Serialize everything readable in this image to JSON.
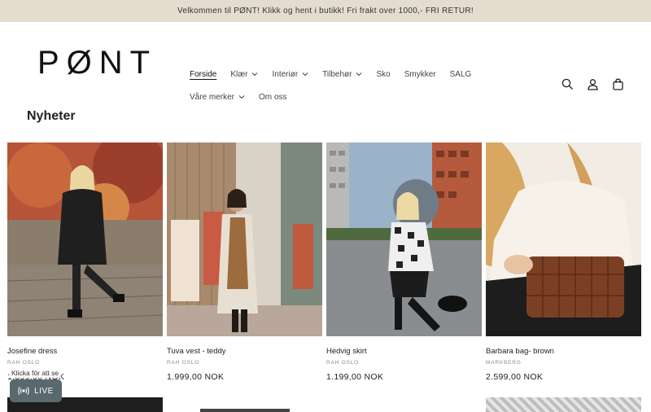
{
  "announcement": "Velkommen til PØNT! Klikk og hent i butikk! Fri frakt over 1000,- FRI RETUR!",
  "brand": {
    "logo_text": "PØNT"
  },
  "nav": [
    {
      "label": "Forside",
      "dropdown": false,
      "active": true
    },
    {
      "label": "Klær",
      "dropdown": true
    },
    {
      "label": "Interiør",
      "dropdown": true
    },
    {
      "label": "Tilbehør",
      "dropdown": true
    },
    {
      "label": "Sko",
      "dropdown": false
    },
    {
      "label": "Smykker",
      "dropdown": false
    },
    {
      "label": "SALG",
      "dropdown": false
    },
    {
      "label": "Våre merker",
      "dropdown": true
    },
    {
      "label": "Om oss",
      "dropdown": false
    }
  ],
  "header_icons": [
    "search-icon",
    "account-icon",
    "cart-icon"
  ],
  "section": {
    "title": "Nyheter"
  },
  "products": [
    {
      "title": "Josefine dress",
      "vendor": "RAH OSLO",
      "price": "1.899,00 NOK"
    },
    {
      "title": "Tuva vest - teddy",
      "vendor": "RAH OSLO",
      "price": "1.999,00 NOK"
    },
    {
      "title": "Hedvig skirt",
      "vendor": "RAH OSLO",
      "price": "1.199,00 NOK"
    },
    {
      "title": "Barbara bag- brown",
      "vendor": "MARKBERG",
      "price": "2.599,00 NOK"
    }
  ],
  "live_widget": {
    "hint": "Klicka för att se",
    "label": "LIVE"
  },
  "colors": {
    "announcement_bg": "#e4ddcf",
    "live_bg": "#5a6870"
  }
}
